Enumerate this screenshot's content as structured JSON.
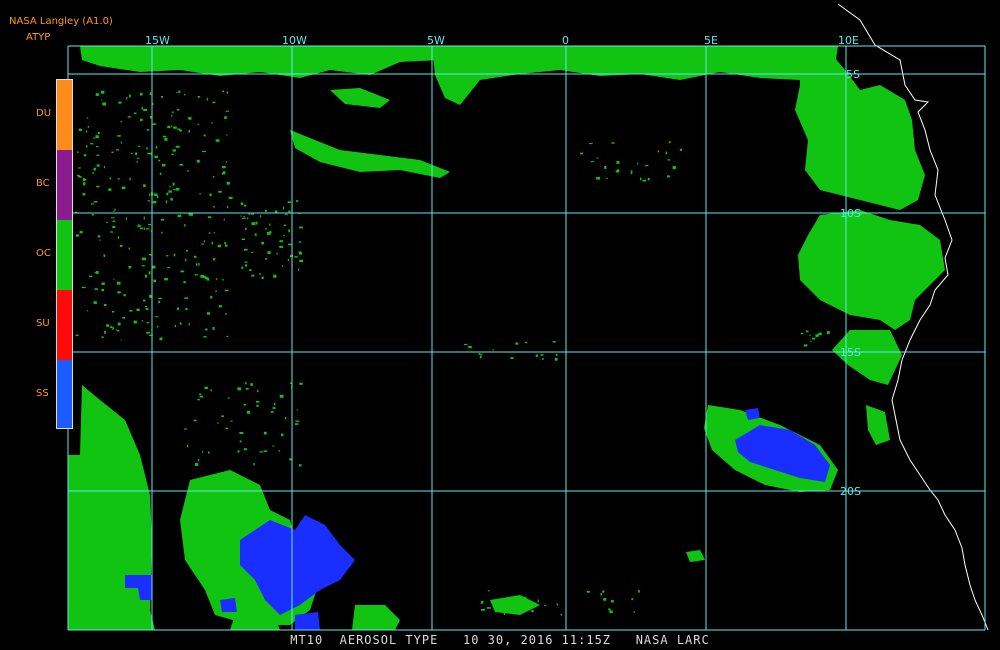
{
  "header": {
    "title": "NASA Langley (A1.0)",
    "subtitle": "ATYP"
  },
  "legend": {
    "items": [
      {
        "code": "DU",
        "color": "#ff8c1a"
      },
      {
        "code": "BC",
        "color": "#8b1c8e"
      },
      {
        "code": "OC",
        "color": "#12c412"
      },
      {
        "code": "SU",
        "color": "#ff0a0a"
      },
      {
        "code": "SS",
        "color": "#1a5cff"
      }
    ]
  },
  "map": {
    "longitude_labels": [
      "15W",
      "10W",
      "5W",
      "0",
      "5E",
      "10E"
    ],
    "latitude_labels": [
      "5S",
      "10S",
      "15S",
      "20S"
    ],
    "grid_color": "#5fe8ee",
    "coastline_color": "#ffffff",
    "land_label_note": "Africa coastline at right"
  },
  "footer": {
    "caption": "MT10  AEROSOL TYPE   10 30, 2016 11:15Z   NASA LARC"
  }
}
